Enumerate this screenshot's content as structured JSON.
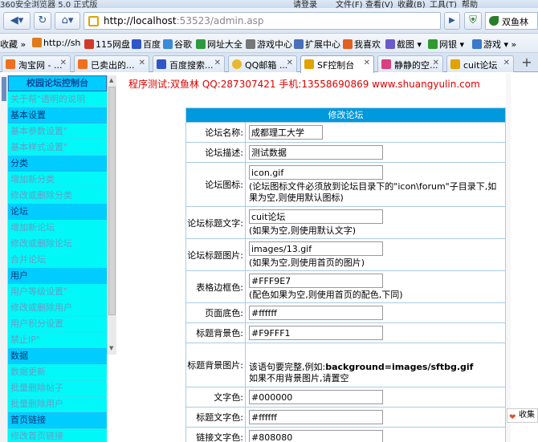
{
  "browser": {
    "title": "360安全浏览器 5.0 正式版",
    "menu": [
      "请登录",
      "文件(F)",
      "查看(V)",
      "收藏(B)",
      "工具(T)",
      "帮助"
    ],
    "url_host": "http://localhost",
    "url_rest": ":53523/admin.asp",
    "search_text": "双鱼林",
    "bookmarks_label": "收藏",
    "bookmarks": [
      "http://sh",
      "115网盘",
      "百度",
      "谷歌",
      "网址大全",
      "游戏中心",
      "扩展中心",
      "我喜欢",
      "截图",
      "网银",
      "游戏"
    ],
    "tabs": [
      "淘宝网 - ...",
      "已卖出的...",
      "百度搜索...",
      "QQ邮箱 ...",
      "SF控制台",
      "静静的空...",
      "cuit论坛"
    ],
    "active_tab": 4
  },
  "sidebar": {
    "title": "校园论坛控制台",
    "items": [
      {
        "type": "link",
        "label": "关于帮\"透明的说明"
      },
      {
        "type": "group",
        "label": "基本设置"
      },
      {
        "type": "link",
        "label": "基本参数设置\""
      },
      {
        "type": "link",
        "label": "基本样式设置\""
      },
      {
        "type": "group",
        "label": "分类"
      },
      {
        "type": "link",
        "label": "增加新分类"
      },
      {
        "type": "link",
        "label": "修改或删除分类"
      },
      {
        "type": "group",
        "label": "论坛"
      },
      {
        "type": "link",
        "label": "增加新论坛"
      },
      {
        "type": "link",
        "label": "修改或删除论坛"
      },
      {
        "type": "link",
        "label": "合并论坛"
      },
      {
        "type": "group",
        "label": "用户"
      },
      {
        "type": "link",
        "label": "用户等级设置\""
      },
      {
        "type": "link",
        "label": "修改或删除用户"
      },
      {
        "type": "link",
        "label": "用户积分设置"
      },
      {
        "type": "link",
        "label": "禁止IP\""
      },
      {
        "type": "group",
        "label": "数据"
      },
      {
        "type": "link",
        "label": "数据更新"
      },
      {
        "type": "link",
        "label": "批量删除帖子"
      },
      {
        "type": "link",
        "label": "批量删除用户"
      },
      {
        "type": "group",
        "label": "首页链接"
      },
      {
        "type": "link",
        "label": "修改首页链接"
      }
    ]
  },
  "banner": "程序测试:双鱼林 QQ:287307421 手机:13558690869 www.shuangyulin.com",
  "form": {
    "title": "修改论坛",
    "name_label": "论坛名称:",
    "name_value": "成都理工大学",
    "desc_label": "论坛描述:",
    "desc_value": "测试数据",
    "icon_label": "论坛图标:",
    "icon_value": "icon.gif",
    "icon_note": "(论坛图标文件必须放到论坛目录下的\"icon\\forum\"子目录下,如果为空,则使用默认图标)",
    "title_text_label": "论坛标题文字:",
    "title_text_value": "cuit论坛",
    "title_text_note": "(如果为空,则使用默认文字)",
    "title_img_label": "论坛标题图片:",
    "title_img_value": "images/13.gif",
    "title_img_note": "(如果为空,则使用首页的图片)",
    "border_label": "表格边框色:",
    "border_value": "#FFF9E7",
    "border_note": "(配色如果为空,则使用首页的配色,下同)",
    "page_bg_label": "页面底色:",
    "page_bg_value": "#ffffff",
    "title_bg_label": "标题背景色:",
    "title_bg_value": "#F9FFF1",
    "title_bgimg_label": "标题背景图片:",
    "title_bgimg_note_prefix": "该语句要完整,例如:",
    "title_bgimg_note_code": "background=images/sftbg.gif",
    "title_bgimg_note2": "如果不用背景图片,请置空",
    "text_color_label": "文字色:",
    "text_color_value": "#000000",
    "title_text_color_label": "标题文字色:",
    "title_text_color_value": "#ffffff",
    "link_color_label": "链接文字色:",
    "link_color_value": "#808080"
  },
  "fav_label": "收集"
}
